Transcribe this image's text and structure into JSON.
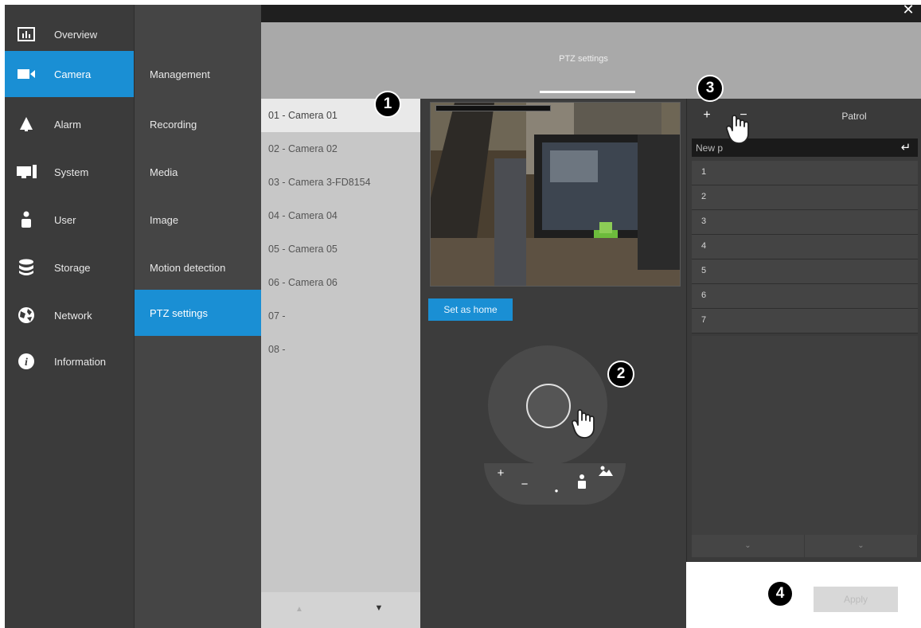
{
  "nav_primary": [
    {
      "label": "Overview",
      "icon": "chart-icon",
      "active": false
    },
    {
      "label": "Camera",
      "icon": "camera-icon",
      "active": true
    },
    {
      "label": "Alarm",
      "icon": "alarm-icon",
      "active": false
    },
    {
      "label": "System",
      "icon": "system-icon",
      "active": false
    },
    {
      "label": "User",
      "icon": "user-icon",
      "active": false
    },
    {
      "label": "Storage",
      "icon": "storage-icon",
      "active": false
    },
    {
      "label": "Network",
      "icon": "network-icon",
      "active": false
    },
    {
      "label": "Information",
      "icon": "info-icon",
      "active": false
    }
  ],
  "nav_secondary": [
    {
      "label": "Management",
      "active": false
    },
    {
      "label": "Recording",
      "active": false
    },
    {
      "label": "Media",
      "active": false
    },
    {
      "label": "Image",
      "active": false
    },
    {
      "label": "Motion detection",
      "active": false
    },
    {
      "label": "PTZ settings",
      "active": true
    }
  ],
  "header": {
    "title": "PTZ settings",
    "close_icon": "close-icon"
  },
  "cameras": [
    {
      "label": "01 - Camera 01",
      "active": true
    },
    {
      "label": "02 - Camera 02",
      "active": false
    },
    {
      "label": "03 - Camera 3-FD8154",
      "active": false
    },
    {
      "label": "04 - Camera 04",
      "active": false
    },
    {
      "label": "05 - Camera 05",
      "active": false
    },
    {
      "label": "06 - Camera 06",
      "active": false
    },
    {
      "label": "07 -",
      "active": false
    },
    {
      "label": "08 -",
      "active": false
    }
  ],
  "preview": {
    "set_home_label": "Set as home"
  },
  "ptz_controls": {
    "zoom_in": "+",
    "zoom_out": "−"
  },
  "patrol": {
    "add_label": "+",
    "remove_label": "−",
    "title": "Patrol",
    "new_preset_placeholder": "New p",
    "rows": [
      "1",
      "2",
      "3",
      "4",
      "5",
      "6",
      "7"
    ],
    "footer_left": "⌄",
    "footer_right": "⌄"
  },
  "apply_label": "Apply",
  "callouts": [
    "1",
    "2",
    "3",
    "4"
  ],
  "colors": {
    "accent": "#1a8fd4",
    "nav_bg": "#3b3b3b",
    "header_bg": "#a9a9a9"
  }
}
